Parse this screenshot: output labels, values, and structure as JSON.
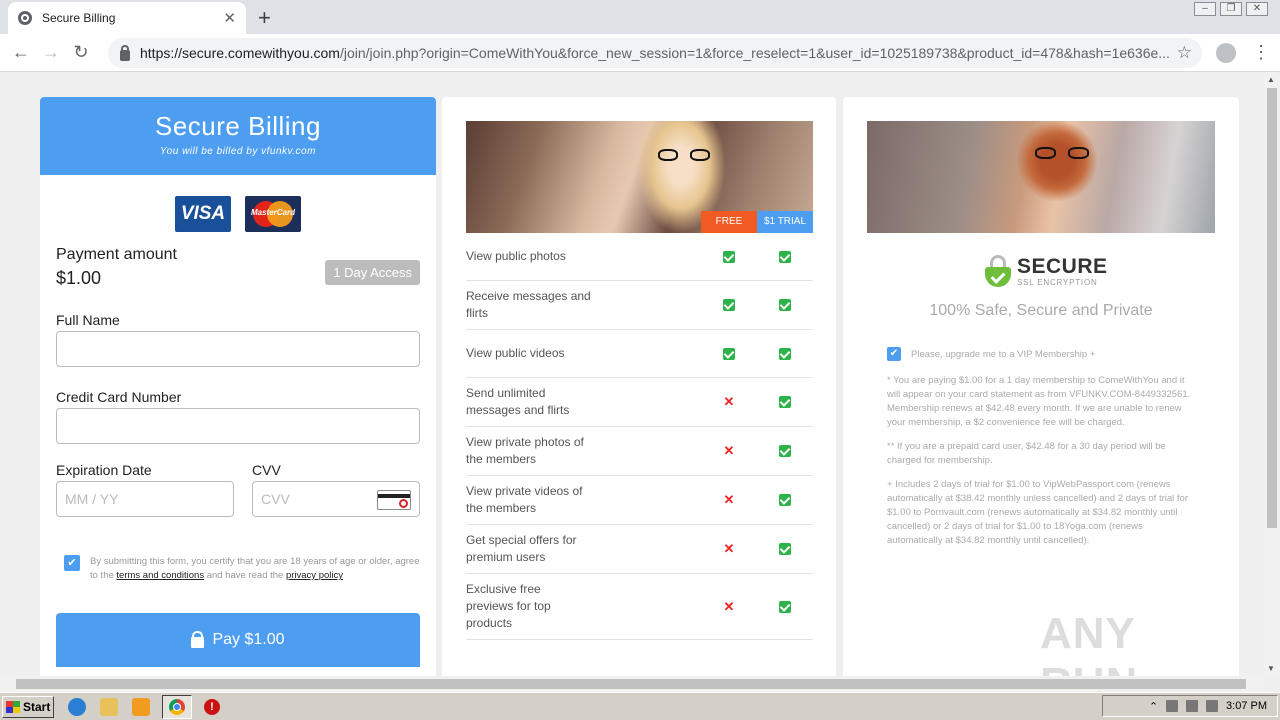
{
  "browser": {
    "tab_title": "Secure Billing",
    "url_host": "https://secure.comewithyou.com",
    "url_path": "/join/join.php?origin=ComeWithYou&force_new_session=1&force_reselect=1&user_id=1025189738&product_id=478&hash=1e636e..."
  },
  "billing": {
    "title": "Secure Billing",
    "subtitle": "You will be billed by vfunkv.com",
    "visa_label": "VISA",
    "mastercard_label": "MasterCard",
    "payment_label": "Payment amount",
    "payment_amount": "$1.00",
    "access_badge": "1 Day Access",
    "full_name_label": "Full Name",
    "card_number_label": "Credit Card Number",
    "expiration_label": "Expiration Date",
    "expiration_placeholder": "MM / YY",
    "cvv_label": "CVV",
    "cvv_placeholder": "CVV",
    "terms_pre": "By submitting this form, you certify that you are 18 years of age or older, agree to the ",
    "terms_link": "terms and conditions",
    "terms_mid": " and have read the ",
    "privacy_link": "privacy policy",
    "pay_button": "Pay $1.00"
  },
  "features": {
    "tag_free": "FREE",
    "tag_trial": "$1 TRIAL",
    "rows": [
      {
        "label": "View public photos",
        "free": true,
        "trial": true
      },
      {
        "label": "Receive messages and flirts",
        "free": true,
        "trial": true
      },
      {
        "label": "View public videos",
        "free": true,
        "trial": true
      },
      {
        "label": "Send unlimited messages and flirts",
        "free": false,
        "trial": true
      },
      {
        "label": "View private photos of the members",
        "free": false,
        "trial": true
      },
      {
        "label": "View private videos of the members",
        "free": false,
        "trial": true
      },
      {
        "label": "Get special offers for premium users",
        "free": false,
        "trial": true
      },
      {
        "label": "Exclusive free previews for top products",
        "free": false,
        "trial": true
      }
    ]
  },
  "secure": {
    "ssl_title": "SECURE",
    "ssl_sub": "SSL ENCRYPTION",
    "safe_text": "100% Safe, Secure and Private",
    "vip_text": "Please, upgrade me to a VIP Membership +",
    "legal1": "* You are paying $1.00 for a 1 day membership to ComeWithYou and it will appear on your card statement as from VFUNKV.COM-8449332561. Membership renews at $42.48 every month. If we are unable to renew your membership, a $2 convenience fee will be charged.",
    "legal2": "** If you are a prepaid card user, $42.48 for a 30 day period will be charged for membership.",
    "legal3": "+ Includes 2 days of trial for $1.00 to VipWebPassport.com (renews automatically at $38.42 monthly unless cancelled) and 2 days of trial for $1.00 to Pornvault.com (renews automatically at $34.82 monthly until cancelled) or 2 days of trial for $1.00 to 18Yoga.com (renews automatically at $34.82 monthly until cancelled).",
    "watermark": "ANY RUN"
  },
  "taskbar": {
    "start_label": "Start",
    "clock": "3:07 PM"
  }
}
